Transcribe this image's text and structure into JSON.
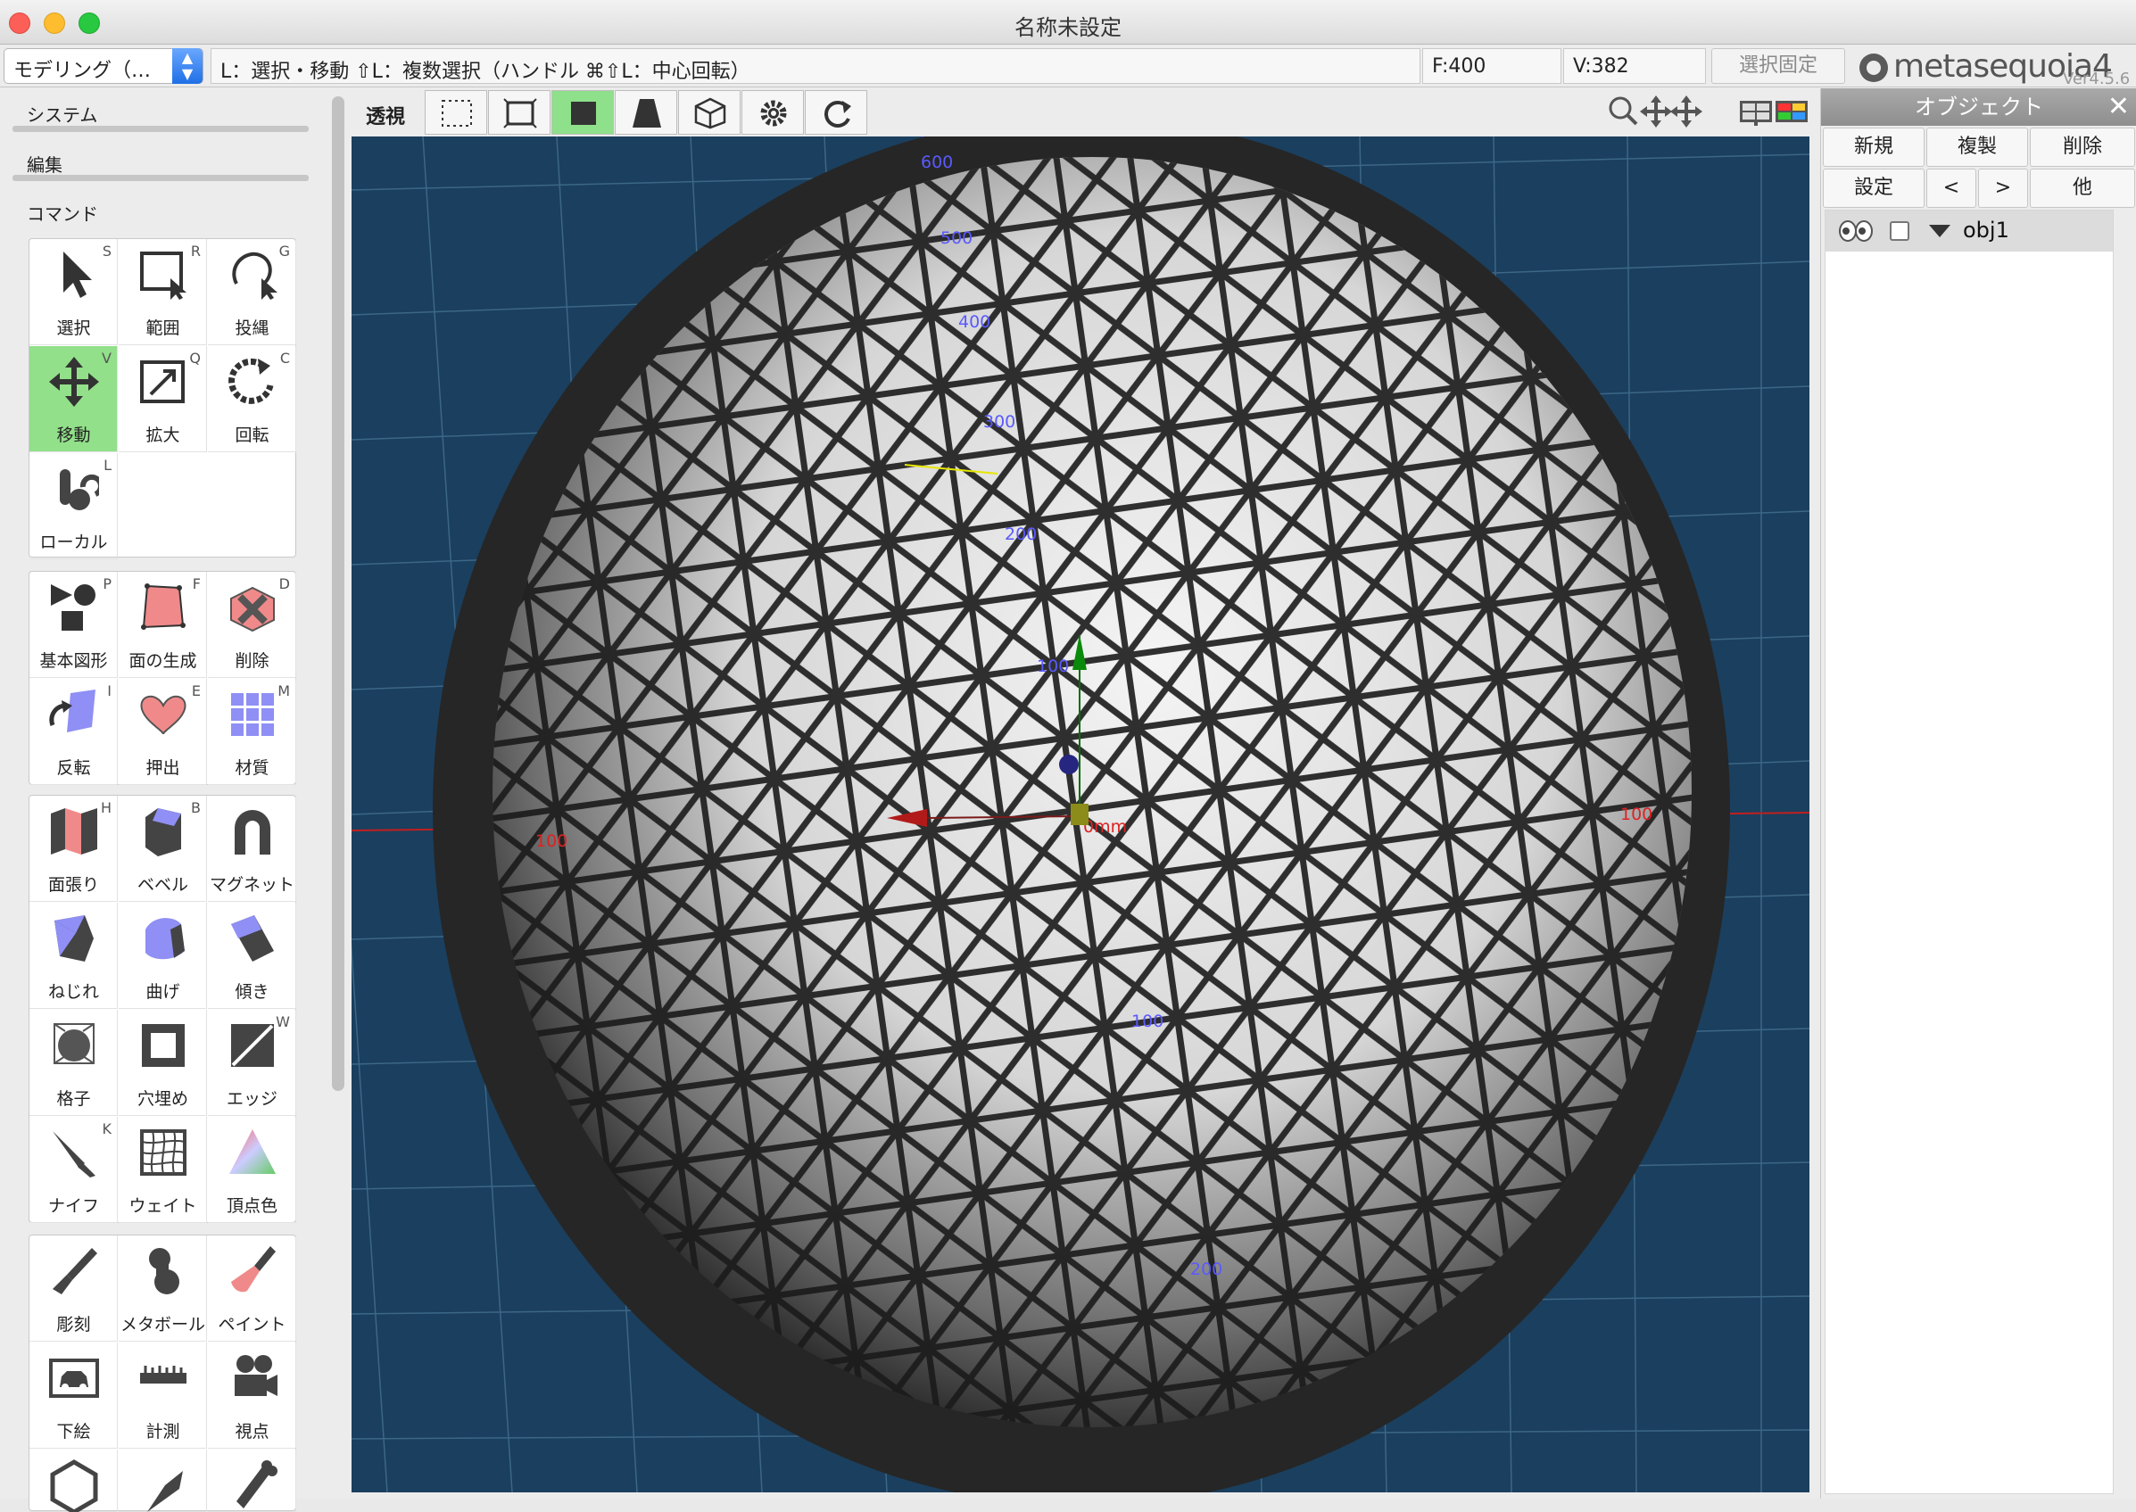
{
  "window": {
    "title": "名称未設定"
  },
  "toolbar": {
    "mode": "モデリング（…",
    "hint": "L：選択・移動  ⇧L：複数選択（ハンドル  ⌘⇧L：中心回転）",
    "faces": "F:400",
    "vertices": "V:382",
    "lock_label": "選択固定",
    "logo_text": "metasequoia4",
    "version": "Ver4.5.6"
  },
  "sidebar": {
    "sections": [
      "システム",
      "編集",
      "コマンド"
    ],
    "groups": [
      [
        {
          "label": "選択",
          "key": "S",
          "icon": "arrow-icon",
          "active": false
        },
        {
          "label": "範囲",
          "key": "R",
          "icon": "rect-select-icon",
          "active": false
        },
        {
          "label": "投縄",
          "key": "G",
          "icon": "lasso-icon",
          "active": false
        },
        {
          "label": "移動",
          "key": "V",
          "icon": "move-icon",
          "active": true
        },
        {
          "label": "拡大",
          "key": "Q",
          "icon": "scale-icon",
          "active": false
        },
        {
          "label": "回転",
          "key": "C",
          "icon": "rotate-icon",
          "active": false
        },
        {
          "label": "ローカル",
          "key": "L",
          "icon": "local-icon",
          "active": false
        }
      ],
      [
        {
          "label": "基本図形",
          "key": "P",
          "icon": "primitive-icon"
        },
        {
          "label": "面の生成",
          "key": "F",
          "icon": "face-create-icon"
        },
        {
          "label": "削除",
          "key": "D",
          "icon": "delete-icon"
        },
        {
          "label": "反転",
          "key": "I",
          "icon": "flip-icon"
        },
        {
          "label": "押出",
          "key": "E",
          "icon": "extrude-icon"
        },
        {
          "label": "材質",
          "key": "M",
          "icon": "material-icon"
        }
      ],
      [
        {
          "label": "面張り",
          "key": "H",
          "icon": "face-fill-icon"
        },
        {
          "label": "ベベル",
          "key": "B",
          "icon": "bevel-icon"
        },
        {
          "label": "マグネット",
          "key": "",
          "icon": "magnet-icon"
        },
        {
          "label": "ねじれ",
          "key": "",
          "icon": "twist-icon"
        },
        {
          "label": "曲げ",
          "key": "",
          "icon": "bend-icon"
        },
        {
          "label": "傾き",
          "key": "",
          "icon": "tilt-icon"
        },
        {
          "label": "格子",
          "key": "",
          "icon": "lattice-icon"
        },
        {
          "label": "穴埋め",
          "key": "",
          "icon": "fill-hole-icon"
        },
        {
          "label": "エッジ",
          "key": "W",
          "icon": "edge-icon"
        },
        {
          "label": "ナイフ",
          "key": "K",
          "icon": "knife-icon"
        },
        {
          "label": "ウェイト",
          "key": "",
          "icon": "weight-icon"
        },
        {
          "label": "頂点色",
          "key": "",
          "icon": "vertex-color-icon"
        }
      ],
      [
        {
          "label": "彫刻",
          "key": "",
          "icon": "sculpt-icon"
        },
        {
          "label": "メタボール",
          "key": "",
          "icon": "metaball-icon"
        },
        {
          "label": "ペイント",
          "key": "",
          "icon": "paint-icon"
        },
        {
          "label": "下絵",
          "key": "",
          "icon": "underlay-icon"
        },
        {
          "label": "計測",
          "key": "",
          "icon": "measure-icon"
        },
        {
          "label": "視点",
          "key": "",
          "icon": "camera-icon"
        }
      ]
    ]
  },
  "viewport": {
    "label": "透視",
    "axis_labels": {
      "y600": "600",
      "y500": "500",
      "y400": "400",
      "y300": "300",
      "y200": "200",
      "y100": "100",
      "x_neg": "100",
      "x_pos": "100",
      "z100": "100",
      "z200": "200",
      "origin": "0mm"
    }
  },
  "panel": {
    "title": "オブジェクト",
    "buttons_row1": [
      "新規",
      "複製",
      "削除"
    ],
    "buttons_row2": [
      "設定",
      "<",
      ">",
      "他"
    ],
    "object_name": "obj1"
  },
  "colors": {
    "viewport_bg": "#1b3f5e",
    "active_tool": "#92e08a",
    "accent_blue": "#1f6fe6"
  }
}
